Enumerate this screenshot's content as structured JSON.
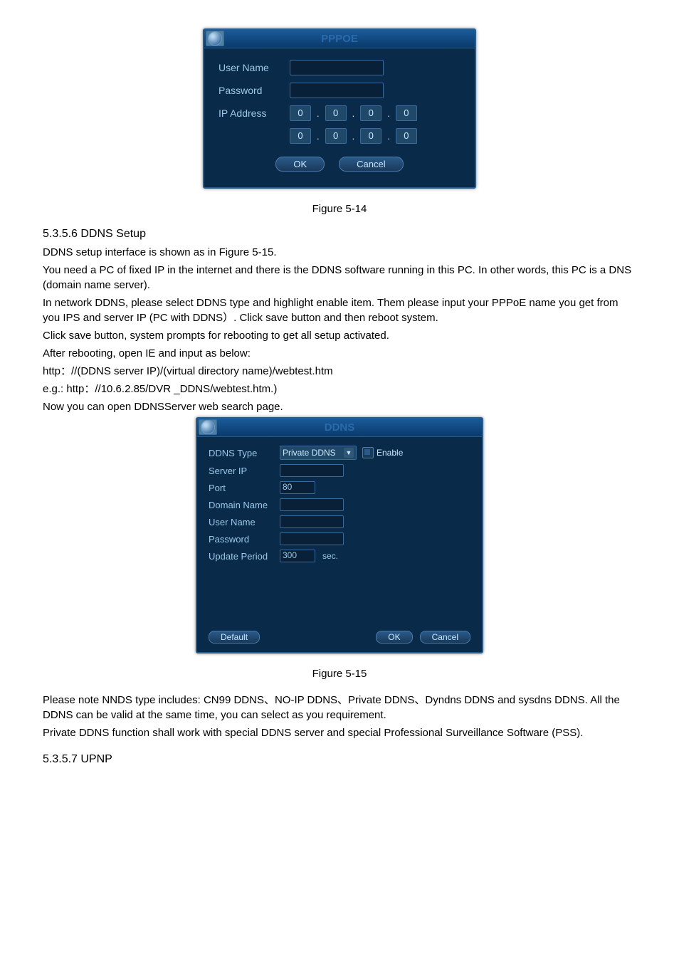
{
  "pppoe": {
    "title": "PPPOE",
    "labels": {
      "userName": "User Name",
      "password": "Password",
      "ipAddress": "IP Address"
    },
    "ip1": [
      "0",
      "0",
      "0",
      "0"
    ],
    "ip2": [
      "0",
      "0",
      "0",
      "0"
    ],
    "buttons": {
      "ok": "OK",
      "cancel": "Cancel"
    }
  },
  "figure514": "Figure 5-14",
  "section1": {
    "heading": "5.3.5.6  DDNS Setup",
    "p1": "DDNS setup interface is shown as in Figure 5-15.",
    "p2": "You need a PC of fixed IP in the internet and there is the DDNS software running in this PC. In other words, this PC is a DNS (domain name server).",
    "p3": "In network DDNS, please select DDNS type and highlight enable item. Them please input your PPPoE name you get from you IPS and server IP (PC with DDNS）. Click save button and then reboot system.",
    "p4": "Click save button, system prompts for rebooting to get all setup activated.",
    "p5": "After rebooting, open IE and input as below:",
    "p6": "http：//(DDNS server IP)/(virtual directory name)/webtest.htm",
    "p7": "e.g.: http：//10.6.2.85/DVR _DDNS/webtest.htm.)",
    "p8": "Now you can open DDNSServer web search page."
  },
  "ddns": {
    "title": "DDNS",
    "labels": {
      "ddnsType": "DDNS Type",
      "serverIP": "Server IP",
      "port": "Port",
      "domainName": "Domain Name",
      "userName": "User Name",
      "password": "Password",
      "updatePeriod": "Update Period"
    },
    "values": {
      "ddnsType": "Private DDNS",
      "port": "80",
      "updatePeriod": "300",
      "sec": "sec."
    },
    "enable": "Enable",
    "buttons": {
      "default": "Default",
      "ok": "OK",
      "cancel": "Cancel"
    }
  },
  "figure515": "Figure 5-15",
  "footer": {
    "p1": "Please note NNDS type includes: CN99 DDNS、NO-IP DDNS、Private DDNS、Dyndns DDNS and sysdns DDNS. All the DDNS can be valid at the same time, you can select as you requirement.",
    "p2": "Private DDNS function shall work with special DDNS server and special Professional Surveillance Software (PSS).",
    "heading": "5.3.5.7  UPNP"
  }
}
